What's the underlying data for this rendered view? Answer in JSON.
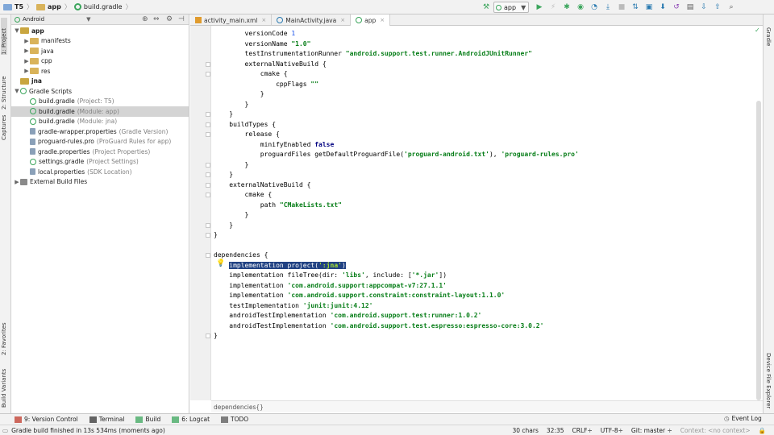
{
  "navbar": {
    "crumbs": [
      "T5",
      "app",
      "build.gradle"
    ],
    "run_config": "app"
  },
  "left_stripe": {
    "project": "1: Project",
    "structure": "2: Structure",
    "captures": "Captures",
    "favorites": "2: Favorites",
    "build_variants": "Build Variants"
  },
  "right_stripe": {
    "gradle": "Gradle",
    "device_explorer": "Device File Explorer"
  },
  "project": {
    "view_mode": "Android",
    "tree": [
      {
        "label": "app",
        "muted": "",
        "depth": 0,
        "kind": "module",
        "arrow": "▼",
        "bold": true
      },
      {
        "label": "manifests",
        "muted": "",
        "depth": 1,
        "kind": "folder",
        "arrow": "▶",
        "bold": false
      },
      {
        "label": "java",
        "muted": "",
        "depth": 1,
        "kind": "folder",
        "arrow": "▶",
        "bold": false
      },
      {
        "label": "cpp",
        "muted": "",
        "depth": 1,
        "kind": "folder",
        "arrow": "▶",
        "bold": false
      },
      {
        "label": "res",
        "muted": "",
        "depth": 1,
        "kind": "folder",
        "arrow": "▶",
        "bold": false
      },
      {
        "label": "jna",
        "muted": "",
        "depth": 0,
        "kind": "module",
        "arrow": "",
        "bold": true
      },
      {
        "label": "Gradle Scripts",
        "muted": "",
        "depth": 0,
        "kind": "gradle",
        "arrow": "▼",
        "bold": false
      },
      {
        "label": "build.gradle",
        "muted": "(Project: T5)",
        "depth": 1,
        "kind": "gradle",
        "arrow": "",
        "bold": false
      },
      {
        "label": "build.gradle",
        "muted": "(Module: app)",
        "depth": 1,
        "kind": "gradle",
        "arrow": "",
        "bold": false
      },
      {
        "label": "build.gradle",
        "muted": "(Module: jna)",
        "depth": 1,
        "kind": "gradle",
        "arrow": "",
        "bold": false
      },
      {
        "label": "gradle-wrapper.properties",
        "muted": "(Gradle Version)",
        "depth": 1,
        "kind": "props",
        "arrow": "",
        "bold": false
      },
      {
        "label": "proguard-rules.pro",
        "muted": "(ProGuard Rules for app)",
        "depth": 1,
        "kind": "props",
        "arrow": "",
        "bold": false
      },
      {
        "label": "gradle.properties",
        "muted": "(Project Properties)",
        "depth": 1,
        "kind": "props",
        "arrow": "",
        "bold": false
      },
      {
        "label": "settings.gradle",
        "muted": "(Project Settings)",
        "depth": 1,
        "kind": "gradle",
        "arrow": "",
        "bold": false
      },
      {
        "label": "local.properties",
        "muted": "(SDK Location)",
        "depth": 1,
        "kind": "props",
        "arrow": "",
        "bold": false
      },
      {
        "label": "External Build Files",
        "muted": "",
        "depth": 0,
        "kind": "ext",
        "arrow": "▶",
        "bold": false
      }
    ],
    "selected_index": 8
  },
  "tabs": [
    {
      "label": "activity_main.xml",
      "active": false
    },
    {
      "label": "MainActivity.java",
      "active": false
    },
    {
      "label": "app",
      "active": true
    }
  ],
  "code": [
    "        versionCode 1",
    "        versionName \"1.0\"",
    "        testInstrumentationRunner \"android.support.test.runner.AndroidJUnitRunner\"",
    "        externalNativeBuild {",
    "            cmake {",
    "                cppFlags \"\"",
    "            }",
    "        }",
    "    }",
    "    buildTypes {",
    "        release {",
    "            minifyEnabled false",
    "            proguardFiles getDefaultProguardFile('proguard-android.txt'), 'proguard-rules.pro'",
    "        }",
    "    }",
    "    externalNativeBuild {",
    "        cmake {",
    "            path \"CMakeLists.txt\"",
    "        }",
    "    }",
    "}",
    "",
    "dependencies {",
    "    implementation project(':jna')",
    "    implementation fileTree(dir: 'libs', include: ['*.jar'])",
    "    implementation 'com.android.support:appcompat-v7:27.1.1'",
    "    implementation 'com.android.support.constraint:constraint-layout:1.1.0'",
    "    testImplementation 'junit:junit:4.12'",
    "    androidTestImplementation 'com.android.support.test:runner:1.0.2'",
    "    androidTestImplementation 'com.android.support.test.espresso:espresso-core:3.0.2'",
    "}"
  ],
  "editor_breadcrumb": "dependencies{}",
  "bottom_tools": [
    {
      "label": "9: Version Control"
    },
    {
      "label": "Terminal"
    },
    {
      "label": "Build"
    },
    {
      "label": "6: Logcat"
    },
    {
      "label": "TODO"
    }
  ],
  "event_log": "Event Log",
  "status": {
    "message": "Gradle build finished in 13s 534ms (moments ago)",
    "chars": "30 chars",
    "position": "32:35",
    "line_sep": "CRLF÷",
    "encoding": "UTF-8÷",
    "git": "Git: master ÷",
    "context": "Context: <no context>"
  },
  "colors": {
    "string": "#067d17",
    "number": "#1750eb",
    "keyword": "#000080",
    "selection": "#214283",
    "gradle_green": "#3ba55c"
  }
}
